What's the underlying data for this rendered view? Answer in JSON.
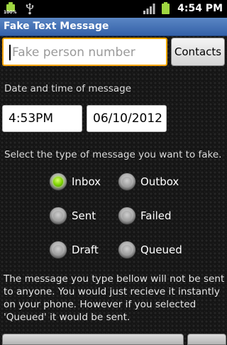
{
  "status_bar": {
    "battery_percent_label": "100%",
    "time": "4:54 PM",
    "icons": [
      "battery-full-icon",
      "usb-icon",
      "signal-icon",
      "battery-icon"
    ],
    "battery_color": "#9fd640"
  },
  "app": {
    "title": "Fake Text Message",
    "title_bar_color": "#4a77bb"
  },
  "phone": {
    "placeholder": "Fake person number",
    "value": ""
  },
  "contacts_button": {
    "label": "Contacts"
  },
  "datetime": {
    "label": "Date and time of message",
    "time_value": "4:53PM",
    "date_value": "06/10/2012"
  },
  "message_type": {
    "label": "Select the type of message you want to fake.",
    "selected": "Inbox",
    "options": [
      {
        "label": "Inbox",
        "checked": true
      },
      {
        "label": "Outbox",
        "checked": false
      },
      {
        "label": "Sent",
        "checked": false
      },
      {
        "label": "Failed",
        "checked": false
      },
      {
        "label": "Draft",
        "checked": false
      },
      {
        "label": "Queued",
        "checked": false
      }
    ]
  },
  "info_text": "The message you type bellow will not be sent to anyone. You would just recieve it instantly on your phone. However if you selected 'Queued' it would be sent."
}
